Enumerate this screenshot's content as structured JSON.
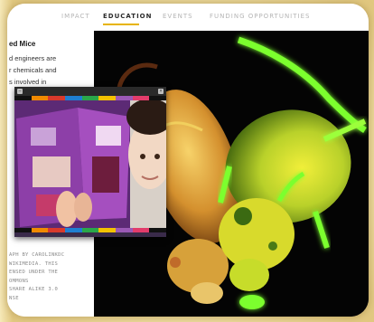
{
  "nav": {
    "items": [
      {
        "label": "IMPACT",
        "active": false
      },
      {
        "label": "EDUCATION",
        "active": true
      },
      {
        "label": "EVENTS",
        "active": false
      },
      {
        "label": "FUNDING OPPORTUNITIES",
        "active": false
      }
    ],
    "accent": "#e7b400"
  },
  "article": {
    "heading": "ed Mice",
    "lines": [
      "d engineers are",
      "r chemicals and",
      "s involved in"
    ],
    "credit_lines": [
      "APH BY CAROLINKDC",
      "WIKIMEDIA. THIS",
      "ENSED UNDER THE",
      "OMMONS",
      "SHARE ALIKE 3.0",
      "NSE"
    ]
  },
  "photo": {
    "subject": "Two glowing fluorescent mice",
    "colors": {
      "glow_green": "#7cff2e",
      "glow_yellow": "#e9e12a",
      "background": "#040404"
    }
  },
  "player": {
    "buttons": [
      "minimize-icon",
      "close-icon"
    ],
    "stripe_colors": [
      "#111111",
      "#f08a00",
      "#d83a2c",
      "#1f7fd1",
      "#2aa84a",
      "#f3c200",
      "#9b59b6",
      "#e23c6b",
      "#111111"
    ],
    "video_subject": "Child reading a purple magazine"
  }
}
